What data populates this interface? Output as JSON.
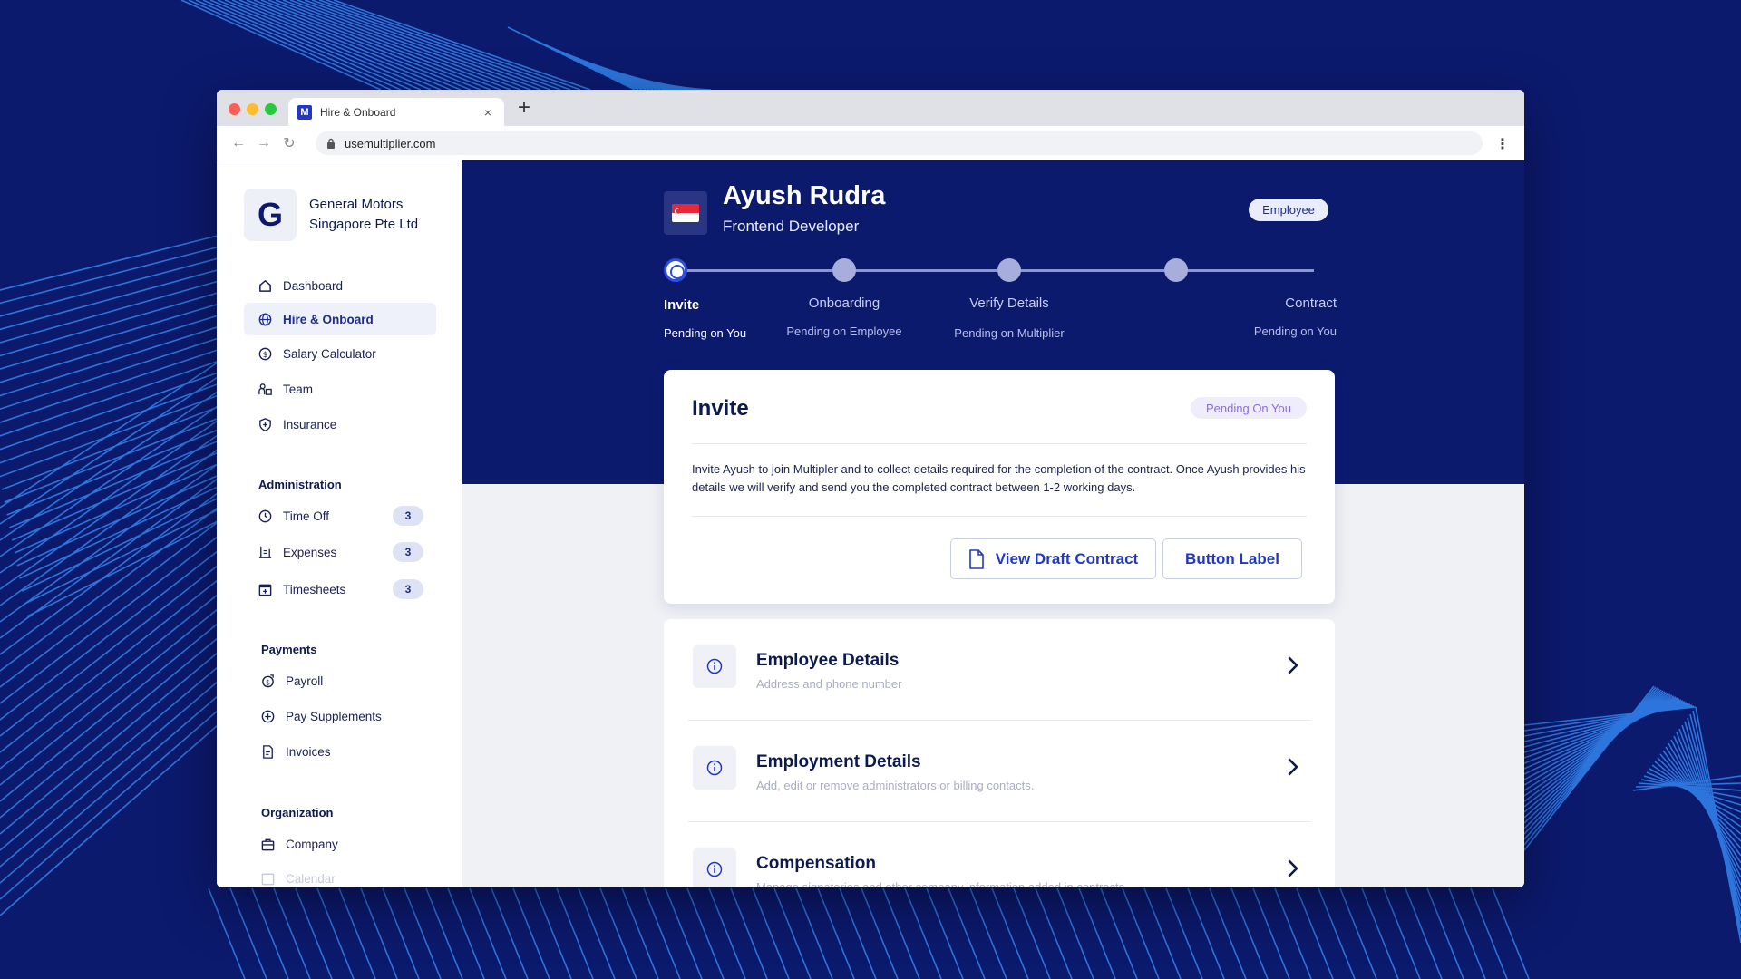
{
  "browser": {
    "tab_title": "Hire & Onboard",
    "tab_favicon": "M",
    "tab_close": "×",
    "new_tab": "+",
    "url": "usemultiplier.com",
    "nav_back": "←",
    "nav_forward": "→",
    "nav_reload": "↻",
    "menu": "⋮"
  },
  "company": {
    "logo_letter": "G",
    "name": "General Motors Singapore Pte Ltd"
  },
  "sidebar": {
    "main_items": [
      {
        "label": "Dashboard",
        "icon": "home-icon"
      },
      {
        "label": "Hire & Onboard",
        "icon": "globe-icon",
        "active": true
      },
      {
        "label": "Salary Calculator",
        "icon": "dollar-circle-icon"
      },
      {
        "label": "Team",
        "icon": "team-icon"
      },
      {
        "label": "Insurance",
        "icon": "shield-plus-icon"
      }
    ],
    "administration": {
      "title": "Administration",
      "items": [
        {
          "label": "Time Off",
          "badge": "3",
          "icon": "clock-icon"
        },
        {
          "label": "Expenses",
          "badge": "3",
          "icon": "receipt-icon"
        },
        {
          "label": "Timesheets",
          "badge": "3",
          "icon": "calendar-plus-icon"
        }
      ]
    },
    "payments": {
      "title": "Payments",
      "items": [
        {
          "label": "Payroll",
          "icon": "payroll-icon"
        },
        {
          "label": "Pay Supplements",
          "icon": "plus-circle-icon"
        },
        {
          "label": "Invoices",
          "icon": "invoice-icon"
        }
      ]
    },
    "organization": {
      "title": "Organization",
      "items": [
        {
          "label": "Company",
          "icon": "briefcase-icon"
        },
        {
          "label": "Calendar",
          "icon": "calendar-icon"
        }
      ]
    }
  },
  "employee": {
    "name": "Ayush Rudra",
    "role": "Frontend Developer",
    "type_badge": "Employee",
    "flag": "singapore-flag"
  },
  "steps": [
    {
      "label": "Invite",
      "status": "Pending on You",
      "active": true
    },
    {
      "label": "Onboarding",
      "status": "Pending on Employee"
    },
    {
      "label": "Verify Details",
      "status": "Pending on Multiplier"
    },
    {
      "label": "Contract",
      "status": "Pending on You"
    }
  ],
  "invite_card": {
    "title": "Invite",
    "badge": "Pending On You",
    "description": "Invite Ayush to join Multipler and to collect details required for the completion of the contract. Once Ayush provides his details we will verify and send you the completed contract  between 1-2 working days.",
    "view_draft_label": "View Draft Contract",
    "button_label": "Button Label"
  },
  "details": [
    {
      "title": "Employee Details",
      "subtitle": "Address and phone number"
    },
    {
      "title": "Employment Details",
      "subtitle": "Add, edit or remove administrators or billing contacts."
    },
    {
      "title": "Compensation",
      "subtitle": "Manage signatories and other company information added in contracts."
    }
  ],
  "colors": {
    "brand_navy": "#0c1a6e",
    "accent_blue": "#2238c4",
    "badge_purple": "#8b6fd6"
  }
}
